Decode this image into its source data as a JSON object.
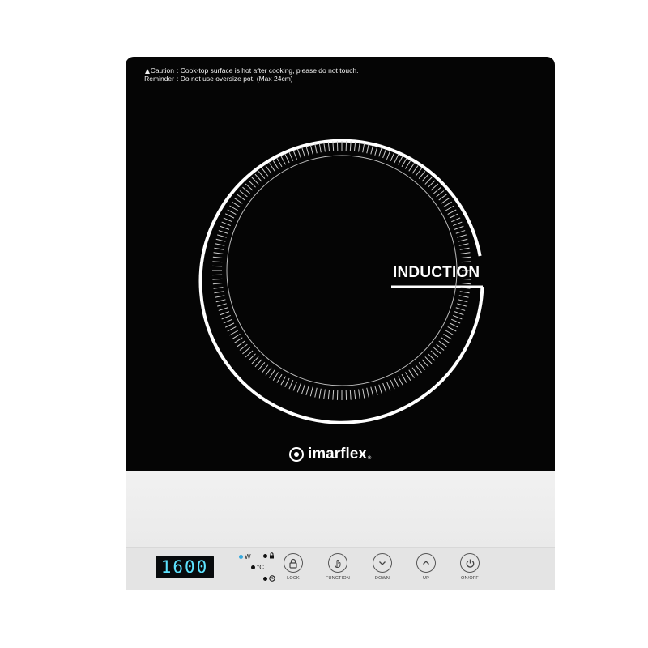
{
  "notice": {
    "caution_label": "Caution",
    "caution_text": ": Cook-top surface is hot after cooking, please do not touch.",
    "reminder_label": "Reminder",
    "reminder_text": ": Do not use oversize pot. (Max 24cm)"
  },
  "zone": {
    "label": "INDUCTION"
  },
  "brand": {
    "name": "imarflex",
    "tm": "®"
  },
  "display": {
    "value": "1600"
  },
  "indicators": [
    {
      "label": "W",
      "active": true
    },
    {
      "label": "°C",
      "active": false
    },
    {
      "label": "lock-indicator-icon",
      "active": false
    },
    {
      "label": "timer-indicator-icon",
      "active": false
    }
  ],
  "buttons": [
    {
      "label": "LOCK",
      "icon": "lock-icon"
    },
    {
      "label": "FUNCTION",
      "icon": "hand-touch-icon"
    },
    {
      "label": "DOWN",
      "icon": "chevron-down-icon"
    },
    {
      "label": "UP",
      "icon": "chevron-up-icon"
    },
    {
      "label": "ON/OFF",
      "icon": "power-icon"
    }
  ],
  "colors": {
    "glass": "#050505",
    "display_digits": "#5de3ff",
    "indicator_active": "#36a9de",
    "body": "#ececec"
  }
}
